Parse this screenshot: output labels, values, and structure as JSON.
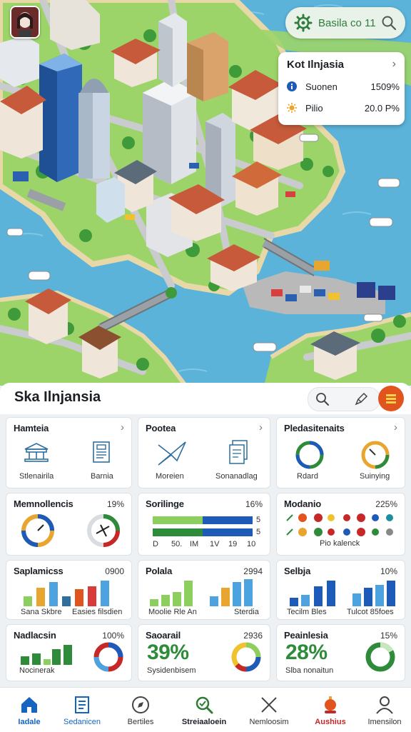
{
  "header": {
    "search_label": "Basila co 11"
  },
  "info_card": {
    "title": "Kot Ilnjasia",
    "rows": [
      {
        "name": "Suonen",
        "value": "1509%"
      },
      {
        "name": "Pilio",
        "value": "20.0 P%"
      }
    ]
  },
  "panel": {
    "title": "Ska Ilnjansia"
  },
  "cards": {
    "hamteia": {
      "title": "Hamteia",
      "items": [
        "Stlenairila",
        "Barnia"
      ]
    },
    "pootea": {
      "title": "Pootea",
      "items": [
        "Moreien",
        "Sonanadlag"
      ]
    },
    "pledasitenaits": {
      "title": "Pledasitenaits",
      "items": [
        "Rdard",
        "Suinying"
      ]
    },
    "memnollencis": {
      "title": "Memnollencis",
      "value": "19%"
    },
    "sorilinge": {
      "title": "Sorilinge",
      "value": "16%",
      "bar_values": [
        "5",
        "5"
      ],
      "axis": [
        "D",
        "50.",
        "IM",
        "1V",
        "19",
        "10"
      ]
    },
    "modanio": {
      "title": "Modanio",
      "value": "225%",
      "caption": "Pio kalenck"
    },
    "saplamicss": {
      "title": "Saplamicss",
      "value": "0900",
      "labels": [
        "Sana Skbre",
        "Easies filsdien"
      ]
    },
    "polala": {
      "title": "Polala",
      "value": "2994",
      "labels": [
        "Moolie Rle An",
        "Sterdia"
      ]
    },
    "selbja": {
      "title": "Selbja",
      "value": "10%",
      "labels": [
        "Tecilm Bles",
        "Tulcot 85foes"
      ]
    },
    "nadlacsin": {
      "title": "Nadlacsin",
      "value": "100%",
      "label": "Nocinerak"
    },
    "saoarail": {
      "title": "Saoarail",
      "value": "2936",
      "big": "39%",
      "label": "Sysidenbisem"
    },
    "peainlesia": {
      "title": "Peainlesia",
      "value": "15%",
      "big": "28%",
      "label": "Slba nonaitun"
    }
  },
  "nav": [
    {
      "label": "Iadale",
      "icon": "home-icon",
      "color": "#1565c0"
    },
    {
      "label": "Sedanicen",
      "icon": "document-icon",
      "color": "#1565c0"
    },
    {
      "label": "Bertiles",
      "icon": "compass-icon",
      "color": "#333333"
    },
    {
      "label": "Streiaaloein",
      "icon": "search-icon",
      "color": "#2e7d32"
    },
    {
      "label": "Nemloosim",
      "icon": "close-icon",
      "color": "#333333"
    },
    {
      "label": "Aushius",
      "icon": "alert-icon",
      "color": "#c62828"
    },
    {
      "label": "Imensilon",
      "icon": "user-icon",
      "color": "#333333"
    }
  ],
  "colors": {
    "water": "#5bb3d9",
    "grass": "#8fcf5c",
    "accent_orange": "#e2541d",
    "green": "#2e8b3a",
    "blue": "#1e5bb8"
  }
}
